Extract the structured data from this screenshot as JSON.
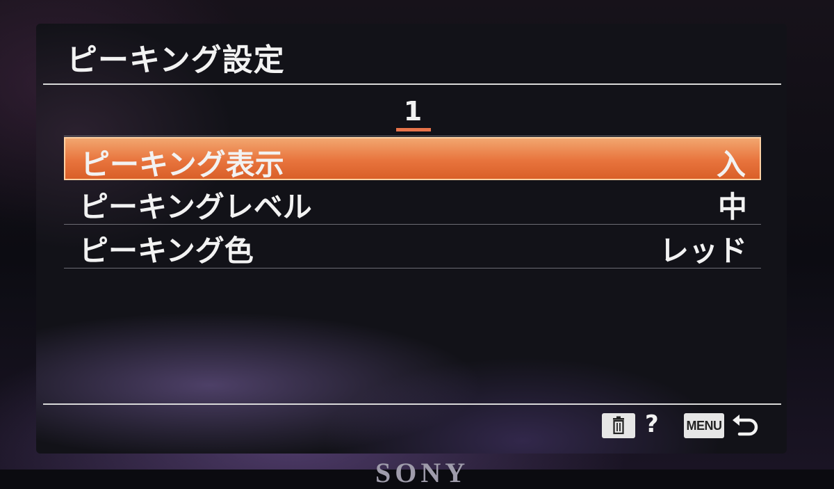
{
  "title": "ピーキング設定",
  "page_indicator": "1",
  "menu_items": [
    {
      "label": "ピーキング表示",
      "value": "入",
      "selected": true
    },
    {
      "label": "ピーキングレベル",
      "value": "中",
      "selected": false
    },
    {
      "label": "ピーキング色",
      "value": "レッド",
      "selected": false
    }
  ],
  "footer": {
    "delete_icon": "trash-icon",
    "help_label": "?",
    "menu_label": "MENU",
    "back_icon": "return-arrow-icon"
  },
  "brand": "SONY",
  "colors": {
    "accent": "#e8743d",
    "text": "#f2f2f2"
  }
}
